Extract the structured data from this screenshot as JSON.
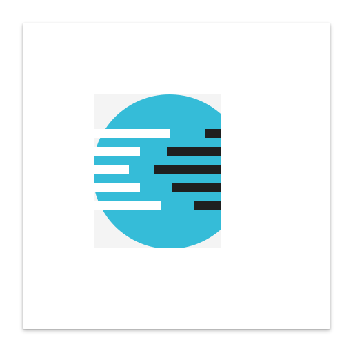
{
  "app_icon": {
    "icon": "app-logo-icon",
    "colors": {
      "card_background": "#ffffff",
      "circle": "#35bcd8",
      "light_bars": "#ffffff",
      "dark_bars": "#1f1f1f",
      "backdrop": "#f4f4f4"
    }
  }
}
